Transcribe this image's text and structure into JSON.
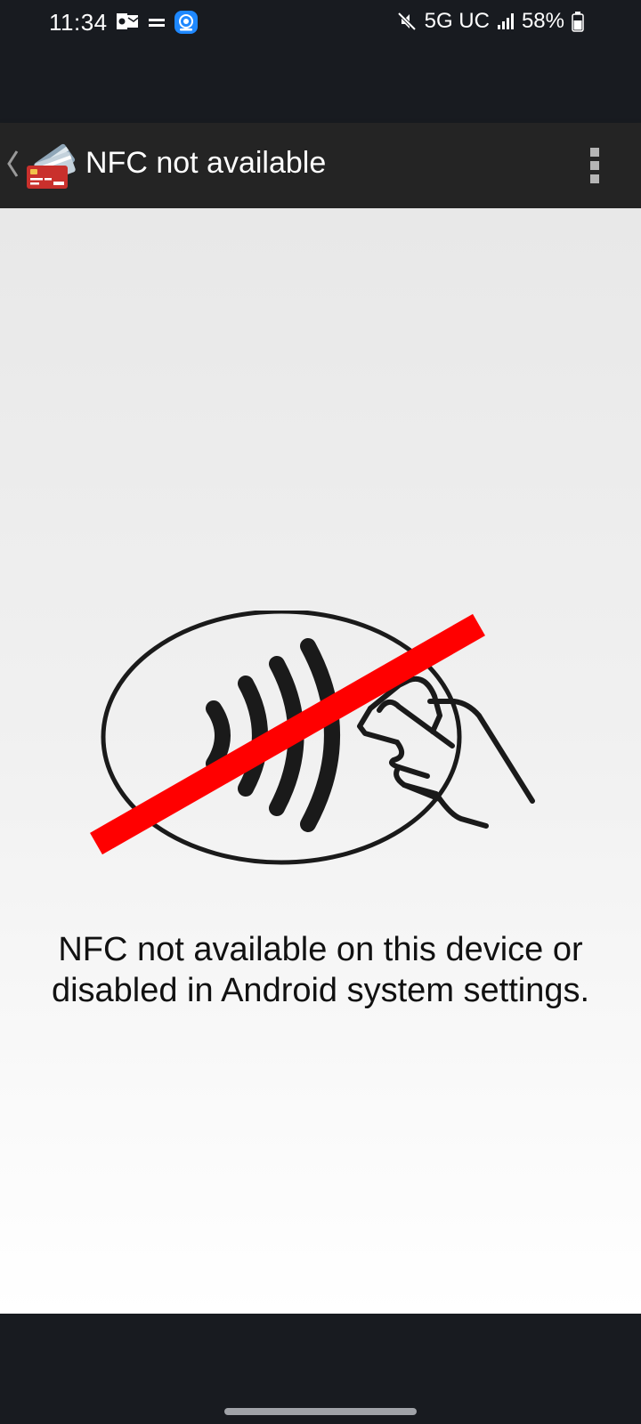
{
  "status_bar": {
    "time": "11:34",
    "network": "5G UC",
    "battery": "58%",
    "icons": [
      "outlook-icon",
      "equal-icon",
      "camera-app-icon",
      "mute-icon",
      "signal-icon",
      "battery-icon"
    ]
  },
  "app_bar": {
    "title": "NFC not available",
    "icons": [
      "back-chevron-icon",
      "credit-card-app-icon",
      "overflow-menu-icon"
    ]
  },
  "content": {
    "message": "NFC not available on this device or disabled in Android system settings.",
    "illustration": "nfc-disabled-illustration",
    "colors": {
      "strike": "#ff0000",
      "line": "#1a1a1a"
    }
  },
  "colors": {
    "system_bar": "#181b20",
    "app_bar": "#242424"
  }
}
